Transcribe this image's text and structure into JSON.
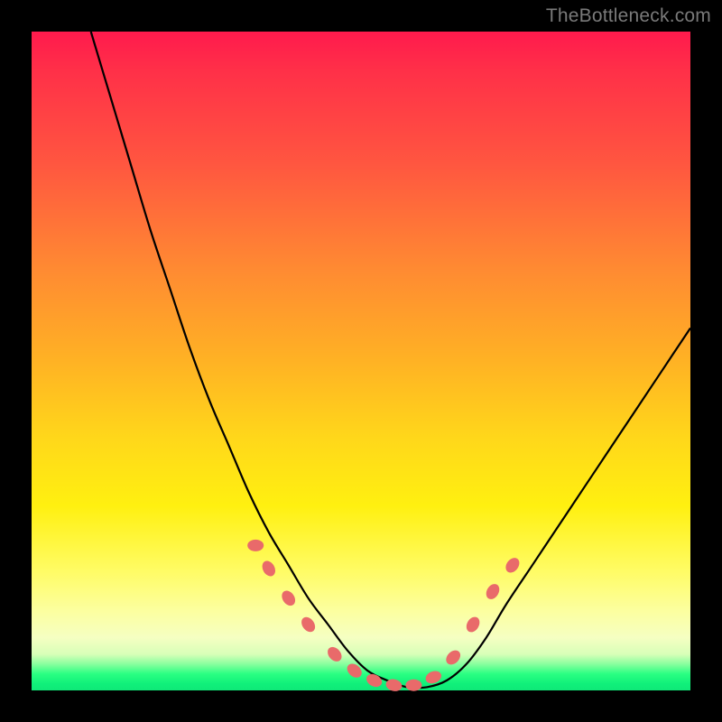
{
  "watermark": "TheBottleneck.com",
  "colors": {
    "frame": "#000000",
    "curve": "#000000",
    "markers": "#e96a6a",
    "gradient_top": "#ff1a4d",
    "gradient_bottom": "#10f07a"
  },
  "chart_data": {
    "type": "line",
    "title": "",
    "xlabel": "",
    "ylabel": "",
    "xlim": [
      0,
      100
    ],
    "ylim": [
      0,
      100
    ],
    "x": [
      9,
      12,
      15,
      18,
      21,
      24,
      27,
      30,
      33,
      36,
      39,
      42,
      45,
      48,
      51,
      54,
      57,
      60,
      63,
      66,
      69,
      72,
      76,
      80,
      84,
      88,
      92,
      96,
      100
    ],
    "values": [
      100,
      90,
      80,
      70,
      61,
      52,
      44,
      37,
      30,
      24,
      19,
      14,
      10,
      6,
      3,
      1.5,
      0.5,
      0.5,
      1.5,
      4,
      8,
      13,
      19,
      25,
      31,
      37,
      43,
      49,
      55
    ],
    "markers": {
      "x": [
        34,
        36,
        39,
        42,
        46,
        49,
        52,
        55,
        58,
        61,
        64,
        67,
        70,
        73
      ],
      "y": [
        22,
        18.5,
        14,
        10,
        5.5,
        3,
        1.5,
        0.8,
        0.8,
        2,
        5,
        10,
        15,
        19
      ],
      "shape": "ellipse"
    }
  }
}
